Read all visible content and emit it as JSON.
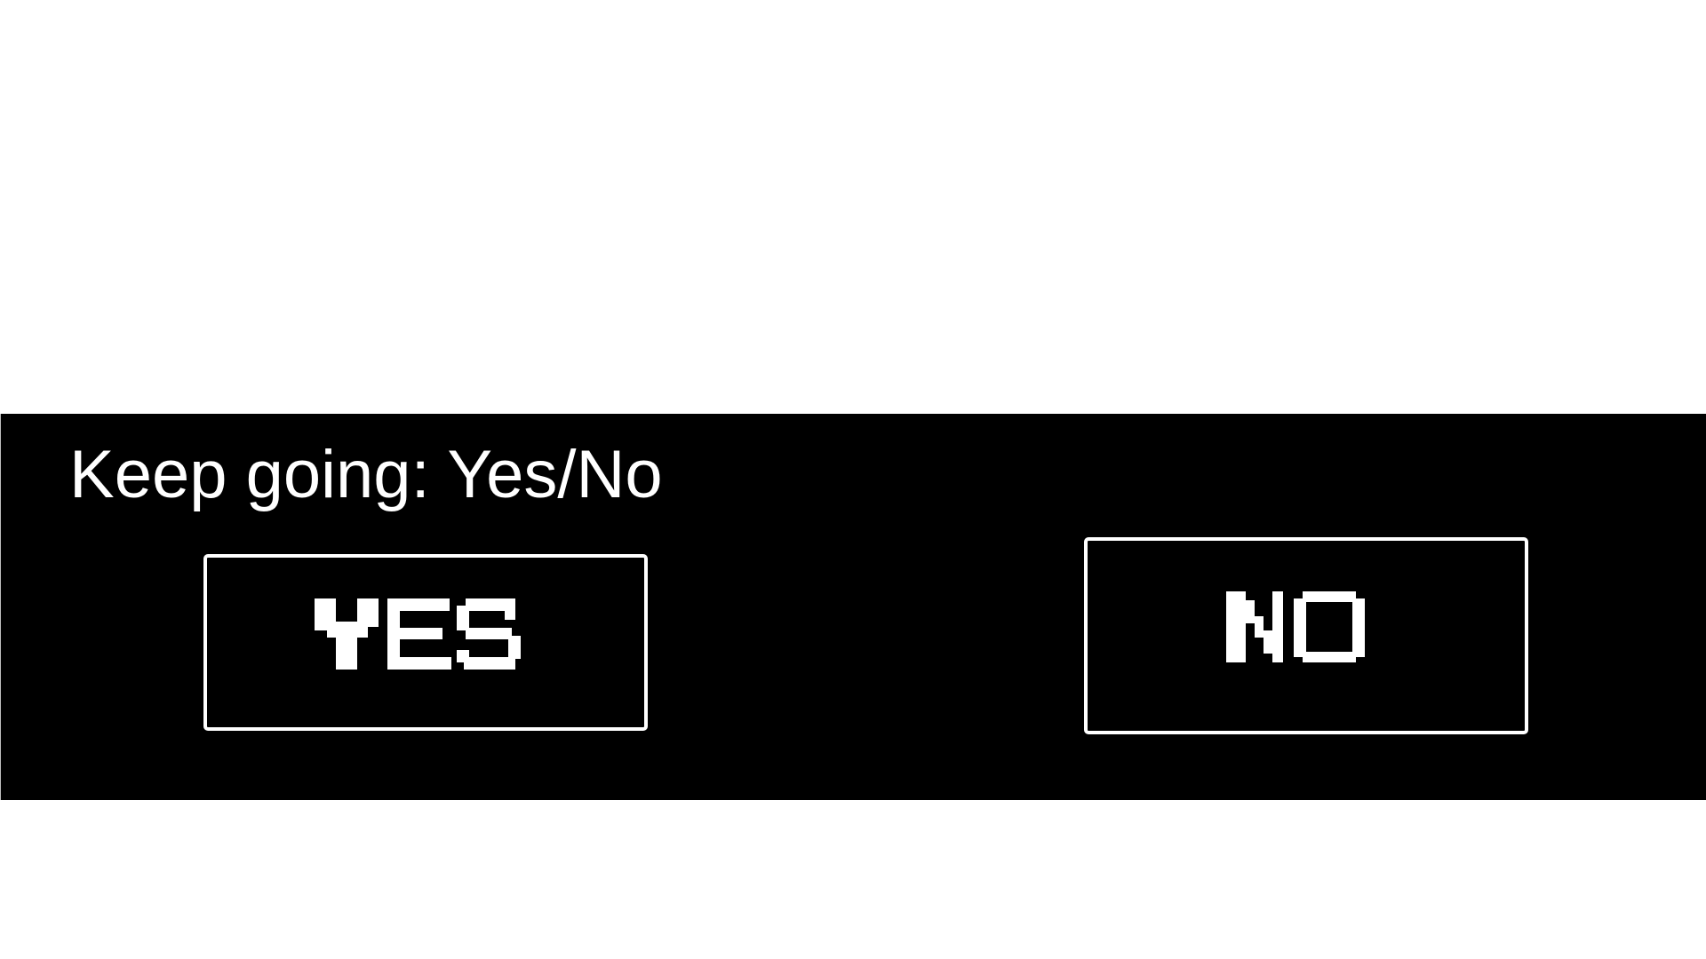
{
  "dialog": {
    "prompt": "Keep going: Yes/No",
    "yes_label": "YES",
    "no_label": "NO"
  },
  "colors": {
    "background": "#ffffff",
    "panel": "#000000",
    "text": "#ffffff",
    "button_border": "#ffffff"
  }
}
